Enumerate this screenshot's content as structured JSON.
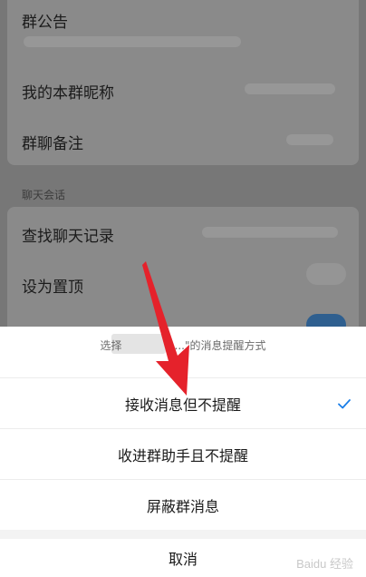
{
  "settings": {
    "announcement_label": "群公告",
    "nickname_label": "我的本群昵称",
    "remark_label": "群聊备注",
    "section_chat": "聊天会话",
    "search_history_label": "查找聊天记录",
    "pin_label": "设为置顶"
  },
  "sheet": {
    "title_prefix": "选择",
    "title_suffix": "...\"的消息提醒方式",
    "options": [
      {
        "label": "接收消息但不提醒",
        "selected": true
      },
      {
        "label": "收进群助手且不提醒",
        "selected": false
      },
      {
        "label": "屏蔽群消息",
        "selected": false
      }
    ],
    "cancel_label": "取消"
  },
  "watermark": "Baidu 经验",
  "colors": {
    "accent": "#1a7ee8",
    "arrow": "#e5222b"
  }
}
